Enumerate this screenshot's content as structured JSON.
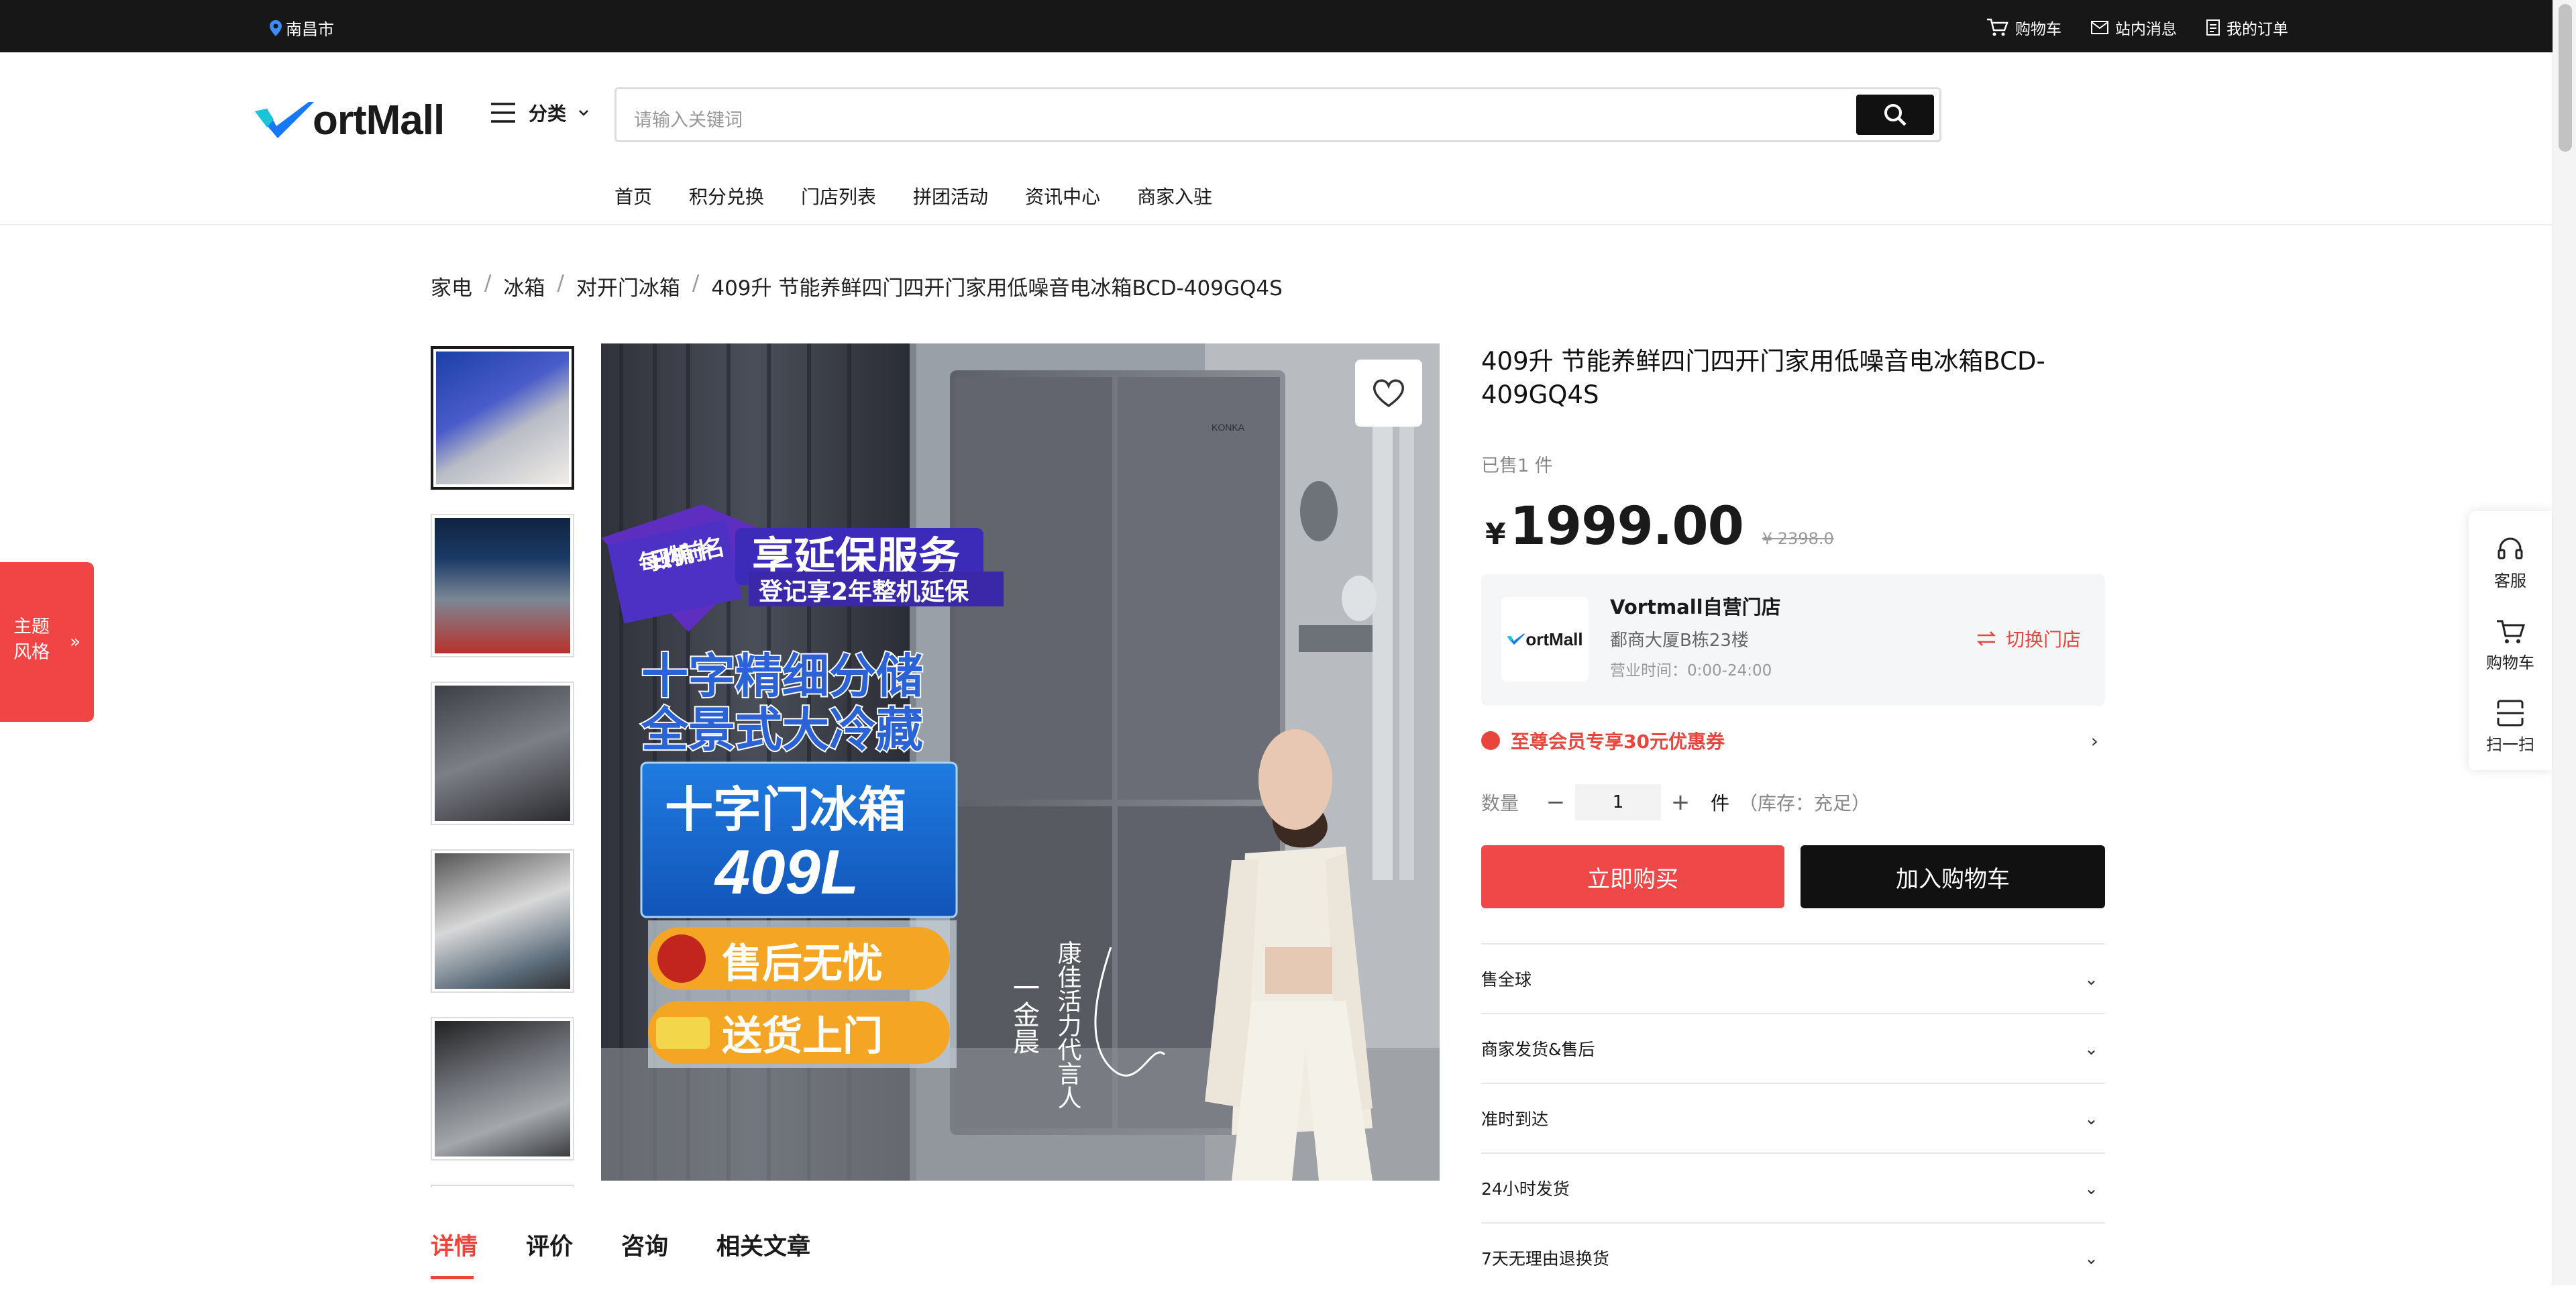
{
  "topbar": {
    "location": "南昌市",
    "links": [
      "购物车",
      "站内消息",
      "我的订单"
    ]
  },
  "header": {
    "logo_text": "ortMall",
    "category_label": "分类",
    "search_placeholder": "请输入关键词",
    "nav": [
      "首页",
      "积分兑换",
      "门店列表",
      "拼团活动",
      "资讯中心",
      "商家入驻"
    ]
  },
  "breadcrumb": [
    "家电",
    "冰箱",
    "对开门冰箱",
    "409升 节能养鲜四门四开门家用低噪音电冰箱BCD-409GQ4S"
  ],
  "gallery": {
    "banner_top": "每日购机前十名",
    "banner_main": "享延保服务",
    "banner_sub": "登记享2年整机延保",
    "line1": "十字精细分储",
    "line2": "全景式大冷藏",
    "box_title": "十字门冰箱",
    "box_vol": "409L",
    "badge1": "售后无忧",
    "badge2": "送货上门",
    "endorse": "康佳活力代言人",
    "name": "一金晨",
    "brand_plate": "KONKA"
  },
  "product": {
    "title": "409升 节能养鲜四门四开门家用低噪音电冰箱BCD-409GQ4S",
    "sold": "已售1 件",
    "currency": "¥",
    "price": "1999.00",
    "old_price": "¥ 2398.0"
  },
  "store": {
    "logo_text": "ortMall",
    "name": "Vortmall自营门店",
    "address": "鄱商大厦B栋23楼",
    "hours": "营业时间：0:00-24:00",
    "switch_label": "切换门店"
  },
  "coupon": {
    "text": "至尊会员专享30元优惠券"
  },
  "quantity": {
    "label": "数量",
    "value": "1",
    "unit": "件",
    "stock": "（库存：充足）"
  },
  "actions": {
    "buy": "立即购买",
    "cart": "加入购物车"
  },
  "features": [
    "售全球",
    "商家发货&售后",
    "准时到达",
    "24小时发货",
    "7天无理由退换货"
  ],
  "tabs": [
    "详情",
    "评价",
    "咨询",
    "相关文章"
  ],
  "theme": {
    "line1": "主题",
    "line2": "风格"
  },
  "float": {
    "items": [
      "客服",
      "购物车",
      "扫一扫"
    ]
  },
  "colors": {
    "accent": "#e8453c",
    "dark": "#171717",
    "brand_blue": "#1678ff"
  }
}
